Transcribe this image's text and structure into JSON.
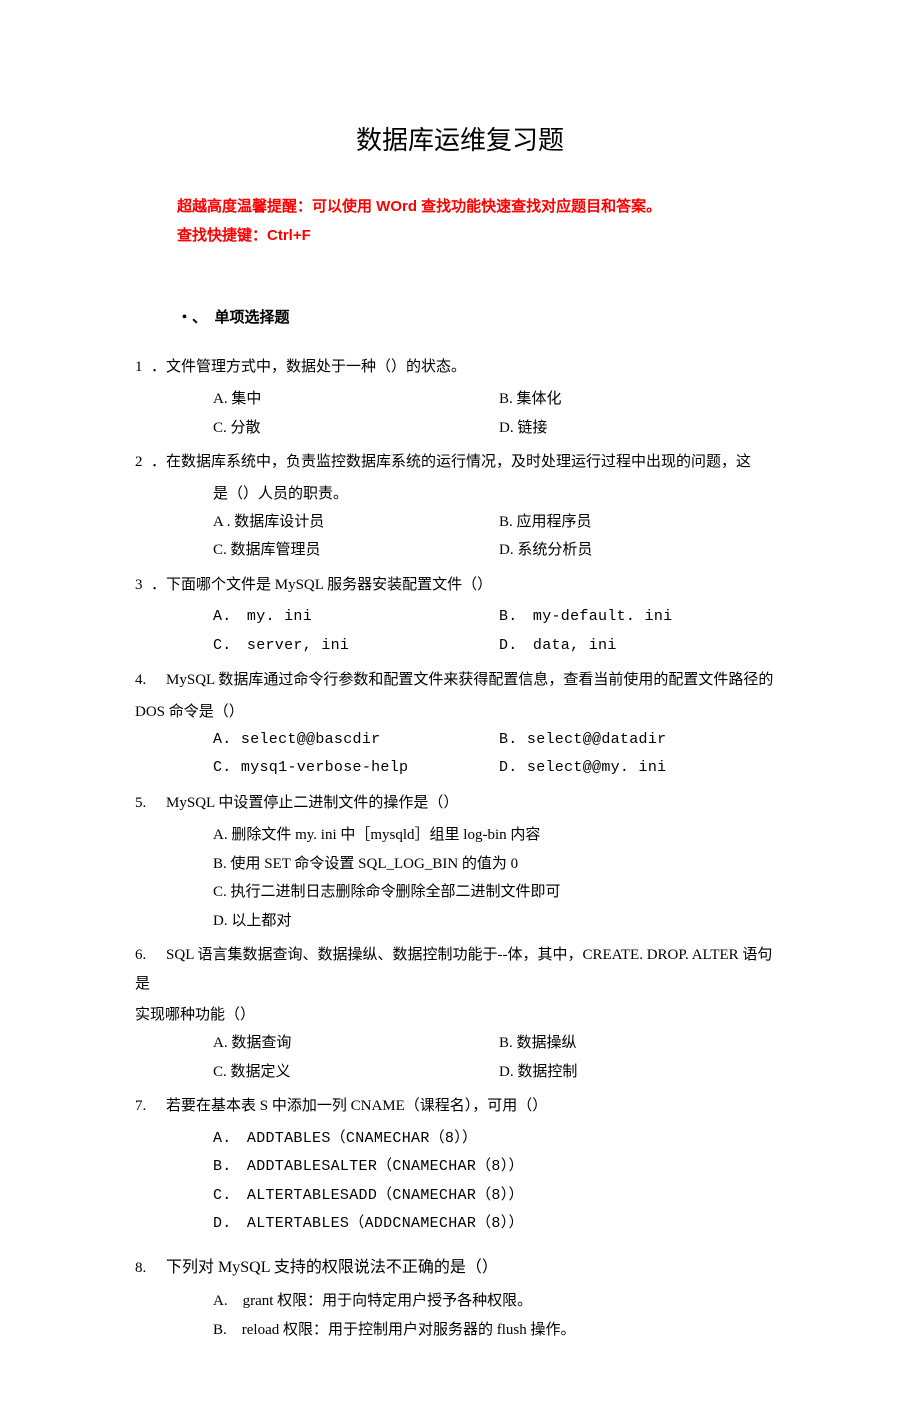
{
  "title": "数据库运维复习题",
  "tip_line1": "超越高度温馨提醒：可以使用 WOrd 查找功能快速查找对应题目和答案。",
  "tip_line2": "查找快捷键：Ctrl+F",
  "section": "・、　单项选择题",
  "q1": {
    "num": "1",
    "stem": "．文件管理方式中，数据处于一种（）的状态。",
    "A": "A. 集中",
    "B": "B. 集体化",
    "C": "C. 分散",
    "D": "D. 链接"
  },
  "q2": {
    "num": "2",
    "stem": "．在数据库系统中，负责监控数据库系统的运行情况，及时处理运行过程中出现的问题，这",
    "stem2": "是（）人员的职责。",
    "A": "A . 数据库设计员",
    "B": "B. 应用程序员",
    "C": "C. 数据库管理员",
    "D": "D. 系统分析员"
  },
  "q3": {
    "num": "3",
    "stem": "．下面哪个文件是 MySQL 服务器安装配置文件（）",
    "A": "A.　my. ini",
    "B": "B.　my-default. ini",
    "C": "C.　server, ini",
    "D": "D.　data, ini"
  },
  "q4": {
    "num": "4.",
    "stem": "MySQL 数据库通过命令行参数和配置文件来获得配置信息，查看当前使用的配置文件路径的",
    "stem2": "DOS 命令是（）",
    "A": "A. select@@bascdir",
    "B": "B. select@@datadir",
    "C": "C. mysq1-verbose-help",
    "D": "D. select@@my. ini"
  },
  "q5": {
    "num": "5.",
    "stem": "MySQL 中设置停止二进制文件的操作是（）",
    "A": "A. 删除文件 my. ini 中［mysqld］组里 log-bin 内容",
    "B": "B. 使用 SET 命令设置 SQL_LOG_BIN 的值为 0",
    "C": "C. 执行二进制日志删除命令删除全部二进制文件即可",
    "D": "D. 以上都对"
  },
  "q6": {
    "num": "6.",
    "stem": "SQL 语言集数据查询、数据操纵、数据控制功能于--体，其中，CREATE. DROP. ALTER 语句是",
    "stem2": "实现哪种功能（）",
    "A": "A. 数据查询",
    "B": "B. 数据操纵",
    "C": "C. 数据定义",
    "D": "D. 数据控制"
  },
  "q7": {
    "num": "7.",
    "stem": "若要在基本表 S 中添加一列 CNAME（课程名），可用（）",
    "A": "A.　ADDTABLES（CNAMECHAR（8））",
    "B": "B.　ADDTABLESALTER（CNAMECHAR（8））",
    "C": "C.　ALTERTABLESADD（CNAMECHAR（8））",
    "D": "D.　ALTERTABLES（ADDCNAMECHAR（8））"
  },
  "q8": {
    "num": "8.",
    "stem": "下列对 MySQL 支持的权限说法不正确的是（）",
    "A": "A.　grant 权限：用于向特定用户授予各种权限。",
    "B": "B.　reload 权限：用于控制用户对服务器的 flush 操作。"
  }
}
